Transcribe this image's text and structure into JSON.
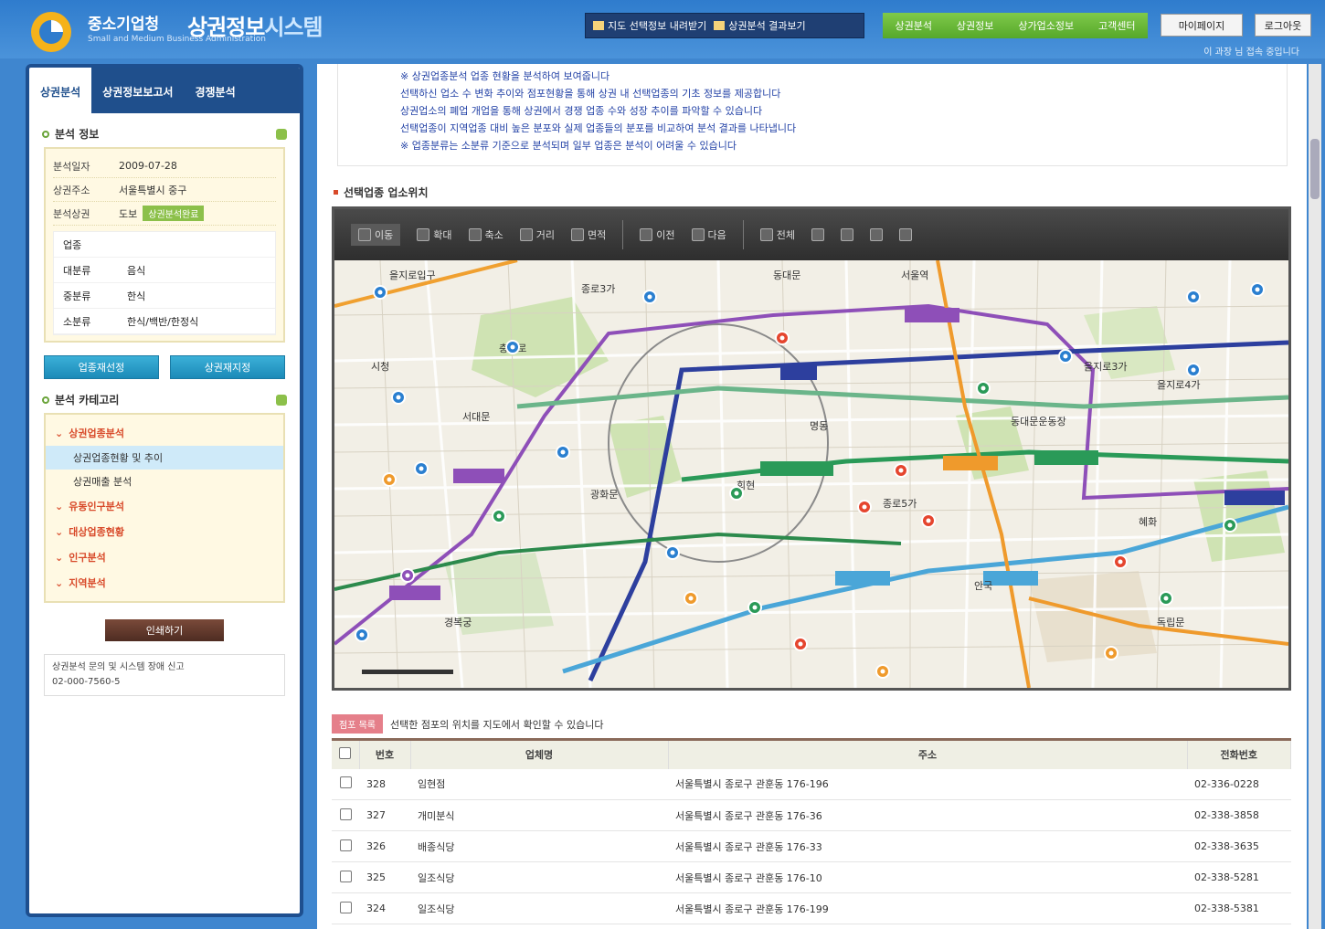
{
  "header": {
    "org_name": "중소기업청",
    "org_sub": "Small and Medium Business Administration",
    "app_title_a": "상권정보",
    "app_title_b": "시스템",
    "nav_btn_1": "지도 선택정보 내려받기",
    "nav_btn_2": "상권분석 결과보기",
    "green_nav": [
      "상권분석",
      "상권정보",
      "상가업소정보",
      "고객센터"
    ],
    "logout_a": "마이페이지",
    "logout_b": "로그아웃",
    "user_info": "이 과장 님 접속 중입니다"
  },
  "left": {
    "tabs": [
      "상권분석",
      "상권정보보고서",
      "경쟁분석"
    ],
    "info_title": "분석 정보",
    "info_rows": [
      {
        "k": "분석일자",
        "v": "2009-07-28"
      },
      {
        "k": "상권주소",
        "v": "서울특별시 중구"
      },
      {
        "k": "분석상권",
        "v": "도보"
      }
    ],
    "badge": "상권분석완료",
    "sub_header": "업종",
    "sub_rows": [
      {
        "k": "대분류",
        "v": "음식"
      },
      {
        "k": "중분류",
        "v": "한식"
      },
      {
        "k": "소분류",
        "v": "한식/백반/한정식"
      }
    ],
    "btn_1": "업종재선정",
    "btn_2": "상권재지정",
    "cat_title": "분석 카테고리",
    "categories": [
      {
        "label": "상권업종분석",
        "subs": [
          "상권업종현황 및 추이",
          "상권매출 분석"
        ]
      },
      {
        "label": "유동인구분석",
        "subs": []
      },
      {
        "label": "대상업종현황",
        "subs": []
      },
      {
        "label": "인구분석",
        "subs": []
      },
      {
        "label": "지역분석",
        "subs": []
      }
    ],
    "print_btn": "인쇄하기",
    "contact_line1": "상권분석 문의 및 시스템 장애 신고",
    "contact_line2": "02-000-7560-5"
  },
  "main": {
    "notice_lines": [
      "※ 상권업종분석 업종 현황을 분석하여 보여줍니다",
      "선택하신 업소 수 변화 추이와 점포현황을 통해 상권 내 선택업종의 기초 정보를 제공합니다",
      "상권업소의 폐업 개업을 통해 상권에서 경쟁 업종 수와 성장 추이를 파악할 수 있습니다",
      "선택업종이 지역업종 대비 높은 분포와 실제 업종들의 분포를 비교하여 분석 결과를 나타냅니다",
      "※ 업종분류는 소분류 기준으로 분석되며 일부 업종은 분석이 어려울 수 있습니다"
    ],
    "map_title": "선택업종 업소위치",
    "tools": [
      "이동",
      "확대",
      "축소",
      "거리",
      "면적",
      "이전",
      "다음",
      "전체"
    ],
    "map_labels": [
      "을지로입구",
      "종로3가",
      "동대문",
      "서울역",
      "시청",
      "충무로",
      "명동",
      "회현",
      "광화문",
      "을지로3가",
      "을지로4가",
      "동대문운동장",
      "종로5가",
      "혜화",
      "안국",
      "경복궁",
      "독립문",
      "서대문"
    ],
    "list_tag": "점포 목록",
    "list_note": "선택한 점포의 위치를 지도에서 확인할 수 있습니다",
    "table_headers": [
      "",
      "번호",
      "업체명",
      "주소",
      "전화번호"
    ],
    "table_rows": [
      {
        "no": "328",
        "name": "임현점",
        "addr": "서울특별시 종로구 관훈동 176-196",
        "tel": "02-336-0228"
      },
      {
        "no": "327",
        "name": "개미분식",
        "addr": "서울특별시 종로구 관훈동 176-36",
        "tel": "02-338-3858"
      },
      {
        "no": "326",
        "name": "배종식당",
        "addr": "서울특별시 종로구 관훈동 176-33",
        "tel": "02-338-3635"
      },
      {
        "no": "325",
        "name": "일조식당",
        "addr": "서울특별시 종로구 관훈동 176-10",
        "tel": "02-338-5281"
      },
      {
        "no": "324",
        "name": "일조식당",
        "addr": "서울특별시 종로구 관훈동 176-199",
        "tel": "02-338-5381"
      }
    ]
  },
  "colors": {
    "header": "#2f7ccd",
    "panel_border": "#1e4f8f",
    "accent_green": "#8cc04a",
    "accent_red": "#d84a2a"
  }
}
